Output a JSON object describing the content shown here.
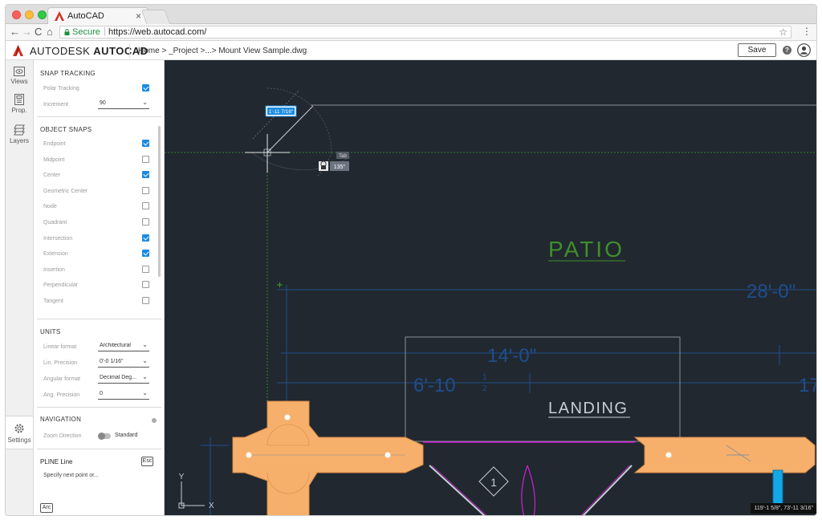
{
  "browser": {
    "tab_title": "AutoCAD",
    "tab_close": "×",
    "secure_label": "Secure",
    "url": "https://web.autocad.com/",
    "nav": {
      "back": "←",
      "forward": "→",
      "reload": "C",
      "home": "⌂"
    },
    "star": "☆",
    "menu": "⋮"
  },
  "app": {
    "brand_prefix": "AUTODESK",
    "brand_product": "AUTOCAD",
    "breadcrumb": "Home > _Project >...> Mount View Sample.dwg",
    "save_label": "Save",
    "help_label": "?"
  },
  "rail": {
    "items": [
      {
        "label": "Views",
        "icon": "eye-icon"
      },
      {
        "label": "Prop.",
        "icon": "properties-icon"
      },
      {
        "label": "Layers",
        "icon": "layers-icon"
      }
    ],
    "settings_label": "Settings"
  },
  "panel": {
    "snap_tracking": {
      "title": "SNAP TRACKING",
      "polar_tracking_label": "Polar Tracking",
      "polar_tracking_checked": true,
      "increment_label": "Increment",
      "increment_value": "90"
    },
    "object_snaps": {
      "title": "OBJECT SNAPS",
      "items": [
        {
          "label": "Endpoint",
          "checked": true
        },
        {
          "label": "Midpoint",
          "checked": false
        },
        {
          "label": "Center",
          "checked": true
        },
        {
          "label": "Geometric Center",
          "checked": false
        },
        {
          "label": "Node",
          "checked": false
        },
        {
          "label": "Quadrant",
          "checked": false
        },
        {
          "label": "Intersection",
          "checked": true
        },
        {
          "label": "Extension",
          "checked": true
        },
        {
          "label": "Insertion",
          "checked": false
        },
        {
          "label": "Perpendicular",
          "checked": false
        },
        {
          "label": "Tangent",
          "checked": false
        }
      ]
    },
    "units": {
      "title": "UNITS",
      "rows": [
        {
          "label": "Linear format",
          "value": "Architectural"
        },
        {
          "label": "Lin. Precision",
          "value": "0'-0 1/16\""
        },
        {
          "label": "Angular format",
          "value": "Decimal Deg..."
        },
        {
          "label": "Ang. Precision",
          "value": "0"
        }
      ]
    },
    "navigation": {
      "title": "NAVIGATION",
      "zoom_label": "Zoom Direction",
      "zoom_value": "Standard"
    },
    "command": {
      "title": "PLINE Line",
      "esc_label": "Esc",
      "prompt": "Specify next point or...",
      "arc_label": "Arc"
    }
  },
  "canvas": {
    "dim_input": "1'-11 7/16\"",
    "tab_hint": "Tab",
    "angle_value": "135°",
    "patio_label": "PATIO",
    "landing_label": "LANDING",
    "dim_28": "28'-0\"",
    "dim_14": "14'-0\"",
    "dim_6": "6'-10",
    "dim_6_frac_num": "1",
    "dim_6_frac_den": "2",
    "dim_17": "17",
    "marker_number": "1",
    "ucs_y": "Y",
    "ucs_x": "X",
    "coords": "119'-1 5/8\", 73'-11 3/16\""
  },
  "colors": {
    "canvas_bg": "#212830",
    "accent_blue": "#1c8be0",
    "wall_fill": "#f7b06b",
    "dim_blue": "#1f4e8c",
    "patio_green": "#3f8f2a",
    "magenta": "#d21fd6"
  }
}
